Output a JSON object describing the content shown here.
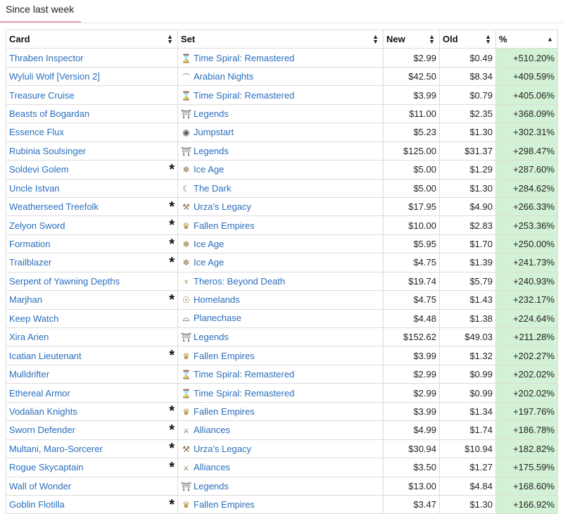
{
  "tab": {
    "label": "Since last week"
  },
  "columns": {
    "card": "Card",
    "set": "Set",
    "new": "New",
    "old": "Old",
    "pct": "%"
  },
  "rows": [
    {
      "card": "Thraben Inspector",
      "star": "",
      "set": "Time Spiral: Remastered",
      "icon": "tsr-icon",
      "glyph": "⌛",
      "new": "$2.99",
      "old": "$0.49",
      "pct": "+510.20%"
    },
    {
      "card": "Wyluli Wolf [Version 2]",
      "star": "",
      "set": "Arabian Nights",
      "icon": "arn-icon",
      "glyph": "⌒",
      "new": "$42.50",
      "old": "$8.34",
      "pct": "+409.59%"
    },
    {
      "card": "Treasure Cruise",
      "star": "",
      "set": "Time Spiral: Remastered",
      "icon": "tsr-icon",
      "glyph": "⌛",
      "new": "$3.99",
      "old": "$0.79",
      "pct": "+405.06%"
    },
    {
      "card": "Beasts of Bogardan",
      "star": "",
      "set": "Legends",
      "icon": "leg-icon",
      "glyph": "⛩",
      "new": "$11.00",
      "old": "$2.35",
      "pct": "+368.09%"
    },
    {
      "card": "Essence Flux",
      "star": "",
      "set": "Jumpstart",
      "icon": "jmp-icon",
      "glyph": "◉",
      "new": "$5.23",
      "old": "$1.30",
      "pct": "+302.31%"
    },
    {
      "card": "Rubinia Soulsinger",
      "star": "",
      "set": "Legends",
      "icon": "leg-icon",
      "glyph": "⛩",
      "new": "$125.00",
      "old": "$31.37",
      "pct": "+298.47%"
    },
    {
      "card": "Soldevi Golem",
      "star": "*",
      "set": "Ice Age",
      "icon": "ice-icon",
      "glyph": "❄",
      "new": "$5.00",
      "old": "$1.29",
      "pct": "+287.60%"
    },
    {
      "card": "Uncle Istvan",
      "star": "",
      "set": "The Dark",
      "icon": "drk-icon",
      "glyph": "☾",
      "new": "$5.00",
      "old": "$1.30",
      "pct": "+284.62%"
    },
    {
      "card": "Weatherseed Treefolk",
      "star": "*",
      "set": "Urza's Legacy",
      "icon": "ulg-icon",
      "glyph": "⚒",
      "new": "$17.95",
      "old": "$4.90",
      "pct": "+266.33%"
    },
    {
      "card": "Zelyon Sword",
      "star": "*",
      "set": "Fallen Empires",
      "icon": "fem-icon",
      "glyph": "♛",
      "new": "$10.00",
      "old": "$2.83",
      "pct": "+253.36%"
    },
    {
      "card": "Formation",
      "star": "*",
      "set": "Ice Age",
      "icon": "ice-icon",
      "glyph": "❄",
      "new": "$5.95",
      "old": "$1.70",
      "pct": "+250.00%"
    },
    {
      "card": "Trailblazer",
      "star": "*",
      "set": "Ice Age",
      "icon": "ice-icon",
      "glyph": "❄",
      "new": "$4.75",
      "old": "$1.39",
      "pct": "+241.73%"
    },
    {
      "card": "Serpent of Yawning Depths",
      "star": "",
      "set": "Theros: Beyond Death",
      "icon": "thb-icon",
      "glyph": "♆",
      "new": "$19.74",
      "old": "$5.79",
      "pct": "+240.93%"
    },
    {
      "card": "Marjhan",
      "star": "*",
      "set": "Homelands",
      "icon": "hml-icon",
      "glyph": "☉",
      "new": "$4.75",
      "old": "$1.43",
      "pct": "+232.17%"
    },
    {
      "card": "Keep Watch",
      "star": "",
      "set": "Planechase",
      "icon": "pch-icon",
      "glyph": "⌓",
      "new": "$4.48",
      "old": "$1.38",
      "pct": "+224.64%"
    },
    {
      "card": "Xira Arien",
      "star": "",
      "set": "Legends",
      "icon": "leg-icon",
      "glyph": "⛩",
      "new": "$152.62",
      "old": "$49.03",
      "pct": "+211.28%"
    },
    {
      "card": "Icatian Lieutenant",
      "star": "*",
      "set": "Fallen Empires",
      "icon": "fem-icon",
      "glyph": "♛",
      "new": "$3.99",
      "old": "$1.32",
      "pct": "+202.27%"
    },
    {
      "card": "Mulldrifter",
      "star": "",
      "set": "Time Spiral: Remastered",
      "icon": "tsr-icon",
      "glyph": "⌛",
      "new": "$2.99",
      "old": "$0.99",
      "pct": "+202.02%"
    },
    {
      "card": "Ethereal Armor",
      "star": "",
      "set": "Time Spiral: Remastered",
      "icon": "tsr-icon",
      "glyph": "⌛",
      "new": "$2.99",
      "old": "$0.99",
      "pct": "+202.02%"
    },
    {
      "card": "Vodalian Knights",
      "star": "*",
      "set": "Fallen Empires",
      "icon": "fem-icon",
      "glyph": "♛",
      "new": "$3.99",
      "old": "$1.34",
      "pct": "+197.76%"
    },
    {
      "card": "Sworn Defender",
      "star": "*",
      "set": "Alliances",
      "icon": "all-icon",
      "glyph": "⚔",
      "new": "$4.99",
      "old": "$1.74",
      "pct": "+186.78%"
    },
    {
      "card": "Multani, Maro-Sorcerer",
      "star": "*",
      "set": "Urza's Legacy",
      "icon": "ulg-icon",
      "glyph": "⚒",
      "new": "$30.94",
      "old": "$10.94",
      "pct": "+182.82%"
    },
    {
      "card": "Rogue Skycaptain",
      "star": "*",
      "set": "Alliances",
      "icon": "all-icon",
      "glyph": "⚔",
      "new": "$3.50",
      "old": "$1.27",
      "pct": "+175.59%"
    },
    {
      "card": "Wall of Wonder",
      "star": "",
      "set": "Legends",
      "icon": "leg-icon",
      "glyph": "⛩",
      "new": "$13.00",
      "old": "$4.84",
      "pct": "+168.60%"
    },
    {
      "card": "Goblin Flotilla",
      "star": "*",
      "set": "Fallen Empires",
      "icon": "fem-icon",
      "glyph": "♛",
      "new": "$3.47",
      "old": "$1.30",
      "pct": "+166.92%"
    }
  ]
}
